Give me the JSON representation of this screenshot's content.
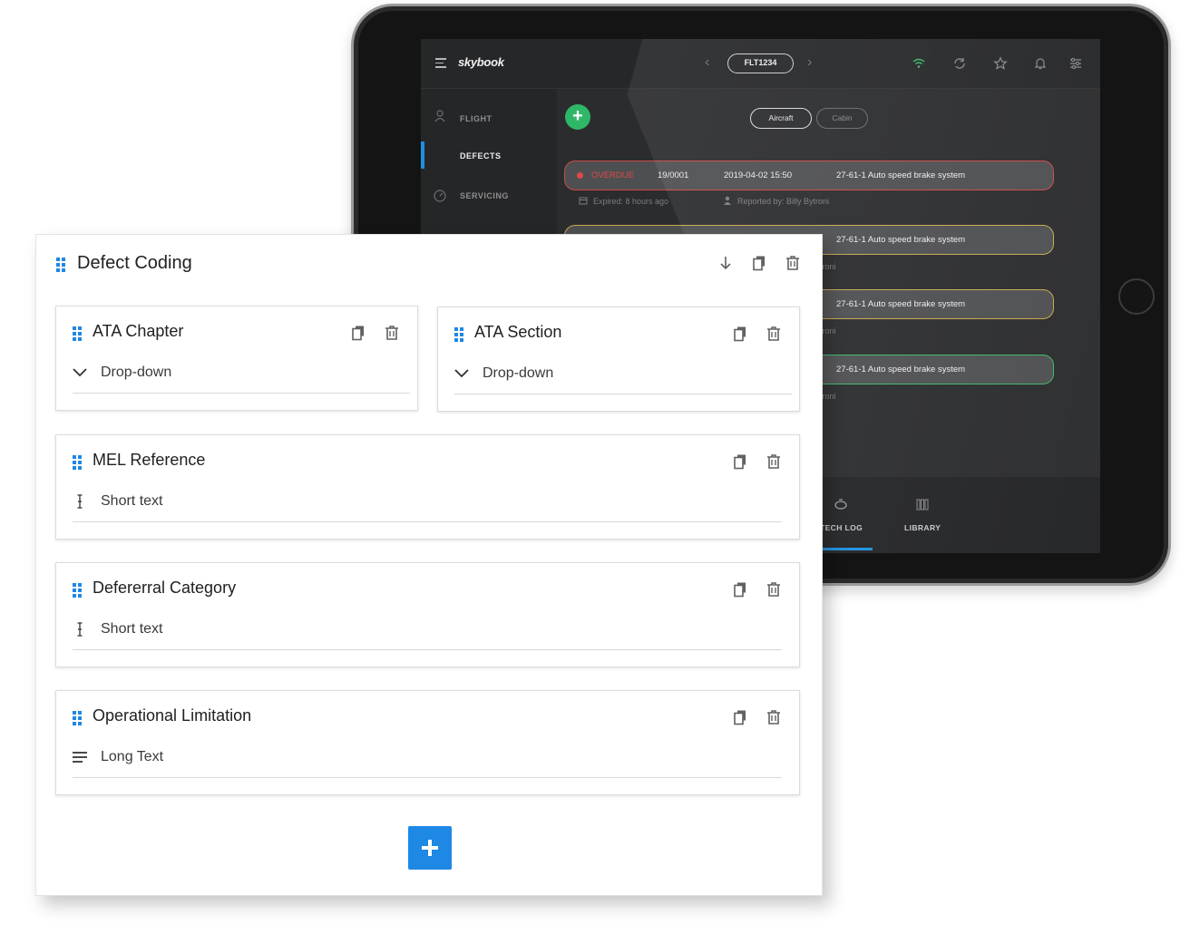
{
  "tablet": {
    "app_logo": "skybook",
    "flight_id": "FLT1234",
    "sidebar": [
      {
        "label": "FLIGHT",
        "active": false
      },
      {
        "label": "DEFECTS",
        "active": true
      },
      {
        "label": "SERVICING",
        "active": false
      }
    ],
    "filters": {
      "aircraft": "Aircraft",
      "cabin": "Cabin"
    },
    "defect_row": {
      "status": "OVERDUE",
      "id": "19/0001",
      "datetime": "2019-04-02 15:50",
      "description": "27-61-1 Auto speed brake system",
      "expired": "Expired: 8 hours ago",
      "reported_by": "Reported by: Billy Bytroni"
    },
    "other_rows": [
      {
        "description": "27-61-1 Auto speed brake system",
        "meta": "troni",
        "border_color": "#c9a84c"
      },
      {
        "description": "27-61-1 Auto speed brake system",
        "meta": "troni",
        "border_color": "#c9a84c"
      },
      {
        "description": "27-61-1 Auto speed brake system",
        "meta": "troni",
        "border_color": "#3fb86b"
      }
    ],
    "bottom_tabs": {
      "tech_log": "TECH LOG",
      "library": "LIBRARY"
    }
  },
  "form": {
    "title": "Defect Coding",
    "fields": [
      {
        "title": "ATA Chapter",
        "type_label": "Drop-down",
        "type_icon": "chevron-down-icon"
      },
      {
        "title": "ATA Section",
        "type_label": "Drop-down",
        "type_icon": "chevron-down-icon"
      },
      {
        "title": "MEL Reference",
        "type_label": "Short text",
        "type_icon": "text-cursor-icon"
      },
      {
        "title": "Defererral Category",
        "type_label": "Short text",
        "type_icon": "text-cursor-icon"
      },
      {
        "title": "Operational Limitation",
        "type_label": "Long Text",
        "type_icon": "text-lines-icon"
      }
    ]
  },
  "colors": {
    "accent": "#1e88e5",
    "overdue": "#e04848",
    "success": "#2fb768",
    "tablet_screen": "#2b2c2e"
  }
}
